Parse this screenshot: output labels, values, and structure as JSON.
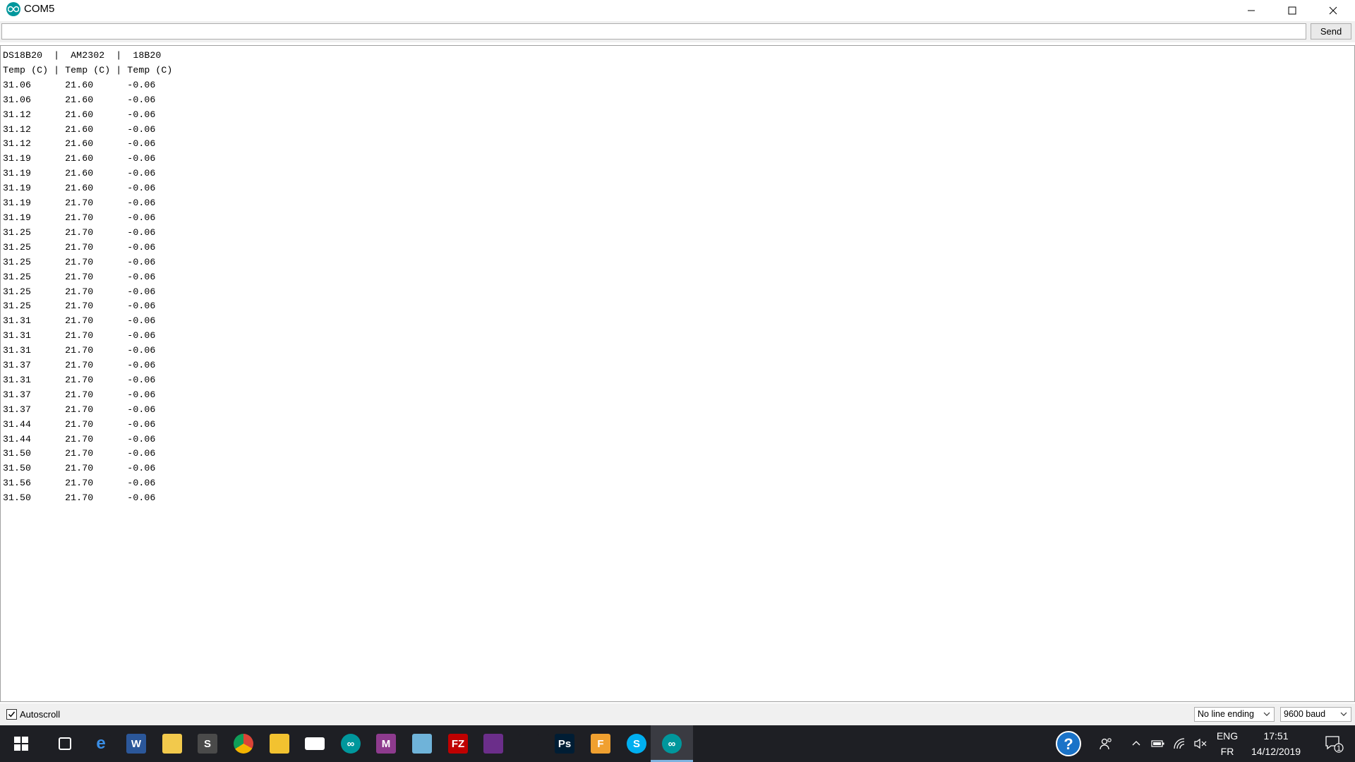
{
  "window": {
    "title": "COM5"
  },
  "send": {
    "input_value": "",
    "button_label": "Send"
  },
  "output": {
    "lines": [
      "DS18B20  |  AM2302  |  18B20",
      "Temp (C) | Temp (C) | Temp (C)",
      "31.06      21.60      -0.06",
      "31.06      21.60      -0.06",
      "31.12      21.60      -0.06",
      "31.12      21.60      -0.06",
      "31.12      21.60      -0.06",
      "31.19      21.60      -0.06",
      "31.19      21.60      -0.06",
      "31.19      21.60      -0.06",
      "31.19      21.70      -0.06",
      "31.19      21.70      -0.06",
      "31.25      21.70      -0.06",
      "31.25      21.70      -0.06",
      "31.25      21.70      -0.06",
      "31.25      21.70      -0.06",
      "31.25      21.70      -0.06",
      "31.25      21.70      -0.06",
      "31.31      21.70      -0.06",
      "31.31      21.70      -0.06",
      "31.31      21.70      -0.06",
      "31.37      21.70      -0.06",
      "31.31      21.70      -0.06",
      "31.37      21.70      -0.06",
      "31.37      21.70      -0.06",
      "31.44      21.70      -0.06",
      "31.44      21.70      -0.06",
      "31.50      21.70      -0.06",
      "31.50      21.70      -0.06",
      "31.56      21.70      -0.06",
      "31.50      21.70      -0.06"
    ]
  },
  "bottom": {
    "autoscroll_label": "Autoscroll",
    "autoscroll_checked": true,
    "line_ending": "No line ending",
    "baud": "9600 baud"
  },
  "taskbar": {
    "apps": [
      {
        "name": "task-view-icon",
        "color": "#1e1f24",
        "glyph": ""
      },
      {
        "name": "edge-icon",
        "color": "#1e1f24",
        "glyph": "e"
      },
      {
        "name": "word-icon",
        "color": "#2b579a",
        "glyph": "W"
      },
      {
        "name": "file-explorer-icon",
        "color": "#f2c94c",
        "glyph": ""
      },
      {
        "name": "sublime-icon",
        "color": "#4a4a4a",
        "glyph": "S"
      },
      {
        "name": "chrome-icon",
        "color": "#1e1f24",
        "glyph": ""
      },
      {
        "name": "fritzing-icon",
        "color": "#f2c230",
        "glyph": ""
      },
      {
        "name": "mail-icon",
        "color": "#1e1f24",
        "glyph": ""
      },
      {
        "name": "arduino-icon",
        "color": "#00979c",
        "glyph": "∞"
      },
      {
        "name": "m-app-icon",
        "color": "#8e3b8e",
        "glyph": "M"
      },
      {
        "name": "notes-icon",
        "color": "#6fb3d9",
        "glyph": ""
      },
      {
        "name": "filezilla-icon",
        "color": "#bf0000",
        "glyph": "FZ"
      },
      {
        "name": "winrar-icon",
        "color": "#6b2e8a",
        "glyph": ""
      },
      {
        "name": "store-icon",
        "color": "#1e1f24",
        "glyph": ""
      },
      {
        "name": "photoshop-icon",
        "color": "#001d34",
        "glyph": "Ps"
      },
      {
        "name": "f-app-icon",
        "color": "#f0a030",
        "glyph": "F"
      },
      {
        "name": "skype-icon",
        "color": "#00aff0",
        "glyph": "S"
      },
      {
        "name": "arduino-active-icon",
        "color": "#00979c",
        "glyph": "∞"
      }
    ],
    "lang_top": "ENG",
    "lang_bottom": "FR",
    "time": "17:51",
    "date": "14/12/2019",
    "notification_count": "1"
  }
}
